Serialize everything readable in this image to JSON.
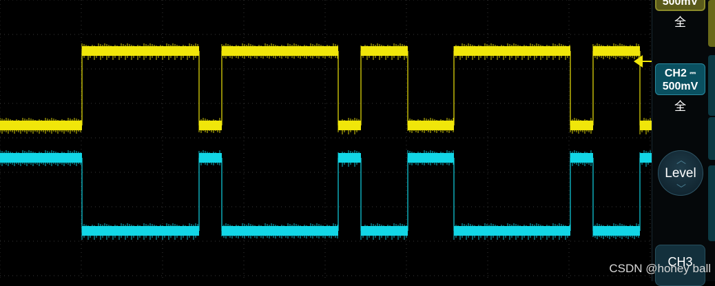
{
  "channels": {
    "ch1": {
      "scale": "500mV",
      "coupling": "全",
      "color": "#f0e60a"
    },
    "ch2": {
      "label": "CH2",
      "scale": "500mV",
      "coupling": "全",
      "coupling_icon": "dc-coupling-icon",
      "color": "#12d6e6"
    },
    "ch3": {
      "label": "CH3"
    }
  },
  "trigger": {
    "label": "Level"
  },
  "watermark": "CSDN @honey ball",
  "colors": {
    "background": "#000000",
    "grid": "#3a3a3a",
    "panel": "#05080a"
  }
}
